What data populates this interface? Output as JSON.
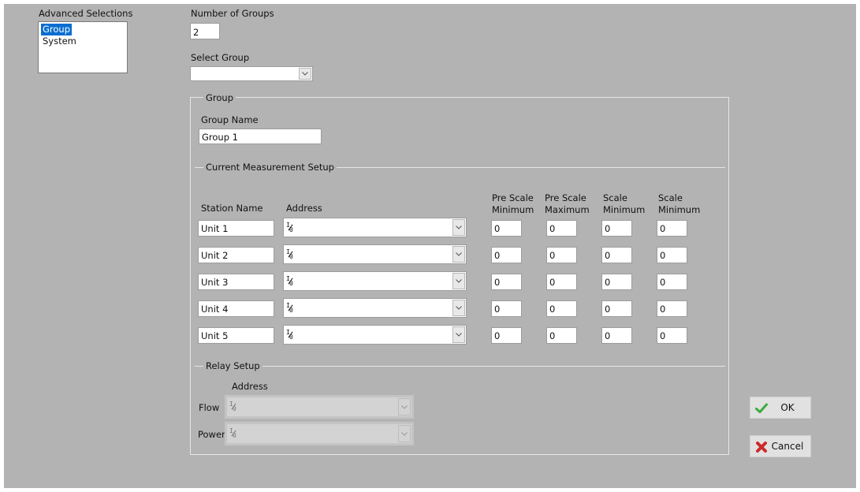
{
  "sidebar": {
    "title": "Advanced Selections",
    "items": [
      {
        "label": "Group",
        "selected": true
      },
      {
        "label": "System",
        "selected": false
      }
    ]
  },
  "number_of_groups": {
    "label": "Number of Groups",
    "value": "2"
  },
  "select_group": {
    "label": "Select Group",
    "value": ""
  },
  "group": {
    "title": "Group",
    "group_name_label": "Group Name",
    "group_name_value": "Group 1"
  },
  "measurement": {
    "title": "Current Measurement Setup",
    "headers": {
      "station_name": "Station Name",
      "address": "Address",
      "pre_scale_min": [
        "Pre Scale",
        "Minimum"
      ],
      "pre_scale_max": [
        "Pre Scale",
        "Maximum"
      ],
      "scale_min": [
        "Scale",
        "Minimum"
      ],
      "scale_min2": [
        "Scale",
        "Minimum"
      ]
    },
    "rows": [
      {
        "station": "Unit 1",
        "address": "I/O",
        "pre_min": "0",
        "pre_max": "0",
        "scale_min": "0",
        "scale_min2": "0"
      },
      {
        "station": "Unit 2",
        "address": "I/O",
        "pre_min": "0",
        "pre_max": "0",
        "scale_min": "0",
        "scale_min2": "0"
      },
      {
        "station": "Unit 3",
        "address": "I/O",
        "pre_min": "0",
        "pre_max": "0",
        "scale_min": "0",
        "scale_min2": "0"
      },
      {
        "station": "Unit 4",
        "address": "I/O",
        "pre_min": "0",
        "pre_max": "0",
        "scale_min": "0",
        "scale_min2": "0"
      },
      {
        "station": "Unit 5",
        "address": "I/O",
        "pre_min": "0",
        "pre_max": "0",
        "scale_min": "0",
        "scale_min2": "0"
      }
    ]
  },
  "relay": {
    "title": "Relay Setup",
    "address_label": "Address",
    "rows": [
      {
        "label": "Flow",
        "address": "I/O"
      },
      {
        "label": "Power",
        "address": "I/O"
      }
    ]
  },
  "buttons": {
    "ok": {
      "label": "OK",
      "icon": "checkmark-icon",
      "color": "#3cab3c"
    },
    "cancel": {
      "label": "Cancel",
      "icon": "x-icon",
      "color": "#cc2a2a"
    }
  },
  "colors": {
    "panel_bg": "#b3b3b3",
    "selection": "#0a6ed1"
  }
}
